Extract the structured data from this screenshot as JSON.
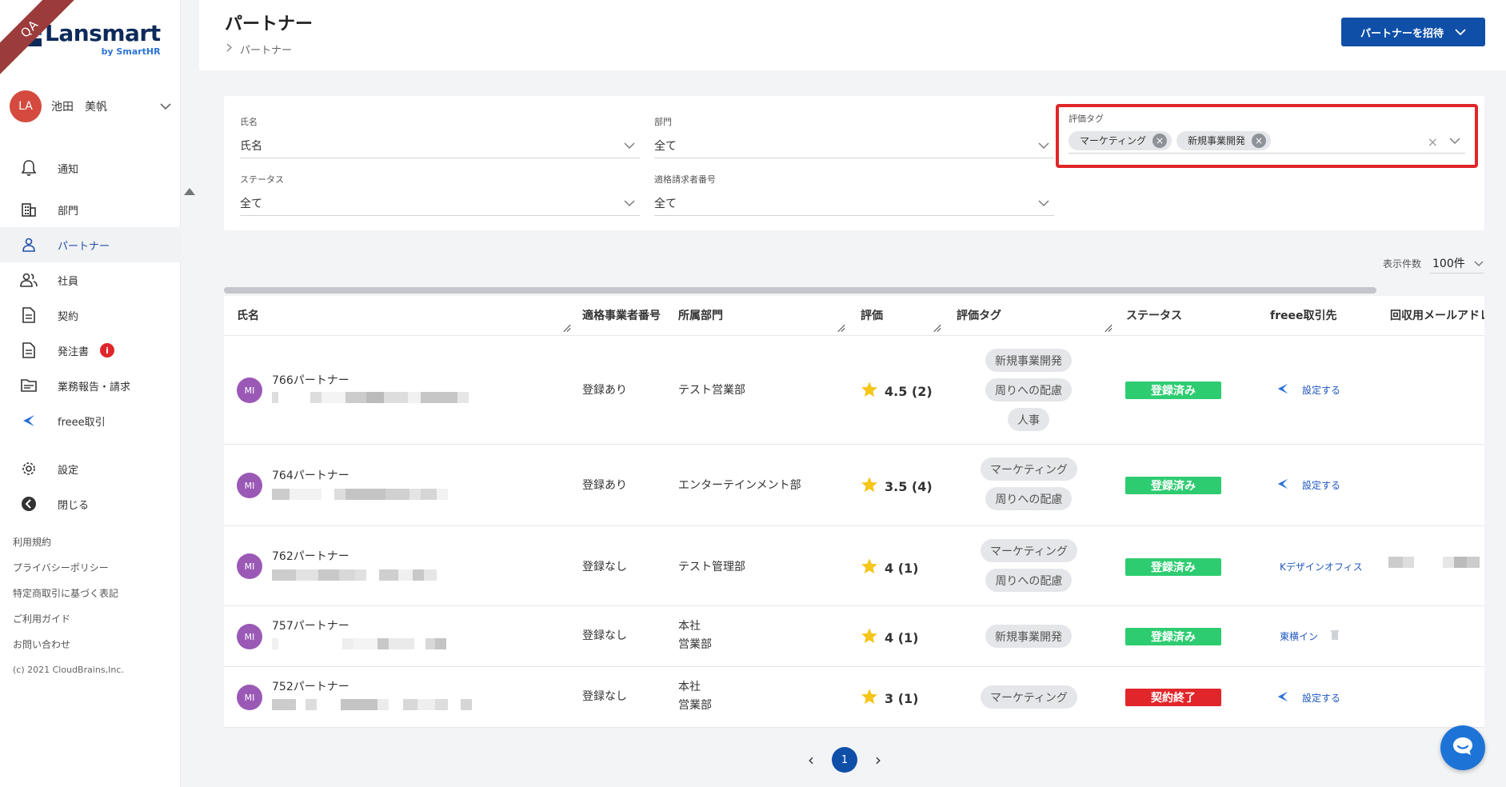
{
  "app": {
    "ribbon": "QA",
    "logo_name": "Lansmart",
    "logo_sub": "by SmartHR"
  },
  "user": {
    "initials": "LA",
    "name": "池田　美帆"
  },
  "nav": {
    "notify": "通知",
    "dept": "部門",
    "partner": "パートナー",
    "employee": "社員",
    "contract": "契約",
    "order": "発注書",
    "order_badge": "i",
    "report": "業務報告・請求",
    "freee": "freee取引",
    "settings": "設定",
    "close": "閉じる"
  },
  "footer": {
    "terms": "利用規約",
    "privacy": "プライバシーポリシー",
    "commerce": "特定商取引に基づく表記",
    "guide": "ご利用ガイド",
    "contact": "お問い合わせ",
    "copyright": "(c) 2021 CloudBrains,Inc."
  },
  "header": {
    "title": "パートナー",
    "breadcrumb": "パートナー",
    "invite_label": "パートナーを招待"
  },
  "filters": {
    "name_label": "氏名",
    "name_placeholder": "氏名",
    "dept_label": "部門",
    "dept_value": "全て",
    "tag_label": "評価タグ",
    "tag_chips": [
      "マーケティング",
      "新規事業開発"
    ],
    "status_label": "ステータス",
    "status_value": "全て",
    "invoice_label": "適格請求者番号",
    "invoice_value": "全て"
  },
  "per_page": {
    "label": "表示件数",
    "value": "100件"
  },
  "table": {
    "columns": {
      "name": "氏名",
      "qualified": "適格事業者番号",
      "dept": "所属部門",
      "rating": "評価",
      "tags": "評価タグ",
      "status": "ステータス",
      "freee": "freee取引先",
      "email": "回収用メールアドレ"
    },
    "rows": [
      {
        "initials": "MI",
        "name": "766パートナー",
        "qualified": "登録あり",
        "dept": "テスト営業部",
        "dept2": "",
        "rating": "4.5 (2)",
        "tags": [
          "新規事業開発",
          "周りへの配慮",
          "人事"
        ],
        "status": "登録済み",
        "freee": "設定する"
      },
      {
        "initials": "MI",
        "name": "764パートナー",
        "qualified": "登録あり",
        "dept": "エンターテインメント部",
        "dept2": "",
        "rating": "3.5 (4)",
        "tags": [
          "マーケティング",
          "周りへの配慮"
        ],
        "status": "登録済み",
        "freee": "設定する"
      },
      {
        "initials": "MI",
        "name": "762パートナー",
        "qualified": "登録なし",
        "dept": "テスト管理部",
        "dept2": "",
        "rating": "4 (1)",
        "tags": [
          "マーケティング",
          "周りへの配慮"
        ],
        "status": "登録済み",
        "freee": "Kデザインオフィス"
      },
      {
        "initials": "MI",
        "name": "757パートナー",
        "qualified": "登録なし",
        "dept": "本社",
        "dept2": "営業部",
        "rating": "4 (1)",
        "tags": [
          "新規事業開発"
        ],
        "status": "登録済み",
        "freee": "東横イン"
      },
      {
        "initials": "MI",
        "name": "752パートナー",
        "qualified": "登録なし",
        "dept": "本社",
        "dept2": "営業部",
        "rating": "3 (1)",
        "tags": [
          "マーケティング"
        ],
        "status": "契約終了",
        "freee": "設定する"
      }
    ]
  },
  "pagination": {
    "prev": "‹",
    "current": "1",
    "next": "›"
  },
  "colors": {
    "primary": "#0f4fa8",
    "status_ok": "#2ecc71",
    "status_end": "#e0262a",
    "highlight": "#e0262a",
    "avatar": "#9b59b6"
  }
}
